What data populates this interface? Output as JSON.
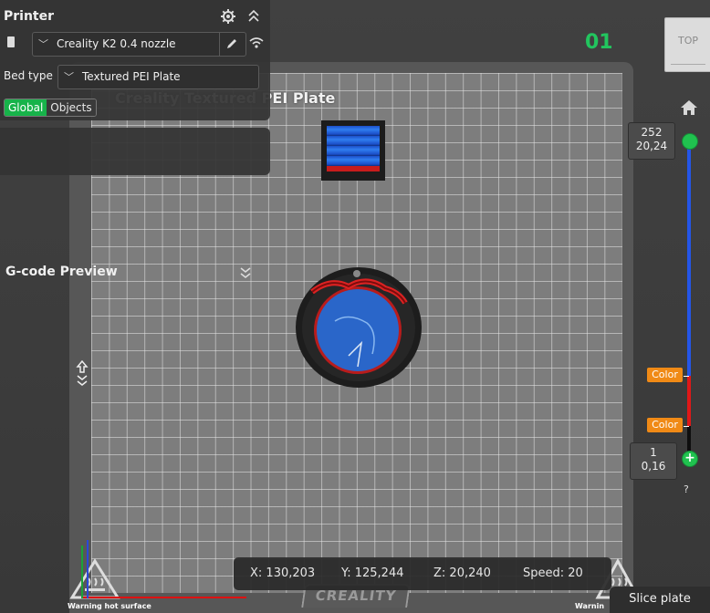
{
  "panel": {
    "title": "Printer",
    "printer": "Creality K2 0.4 nozzle",
    "bed_type_label": "Bed type",
    "bed_type": "Textured PEI Plate",
    "tabs": [
      "Global",
      "Objects"
    ],
    "gcode_title": "G-code Preview"
  },
  "plate": {
    "title": "Creality Textured PEI Plate",
    "index": "01",
    "logo": "CREALITY",
    "warning_left": "Warning hot surface",
    "warning_right": "Warnin"
  },
  "viewcube": {
    "face": "TOP"
  },
  "layer_slider": {
    "top_layer": "252",
    "top_height": "20,24",
    "bottom_layer": "1",
    "bottom_height": "0,16",
    "color_tag_1": "Color",
    "color_tag_2": "Color",
    "help": "?",
    "colors": {
      "upper": "#2456e8",
      "middle": "#e01818",
      "lower": "#0e0e0e",
      "knob": "#20c24f"
    }
  },
  "info": {
    "x": "X: 130,203",
    "y": "Y: 125,244",
    "z": "Z: 20,240",
    "speed": "Speed: 20"
  },
  "slice_button": "Slice plate",
  "colors": {
    "accent": "#17b34a",
    "tag": "#f08a16"
  }
}
